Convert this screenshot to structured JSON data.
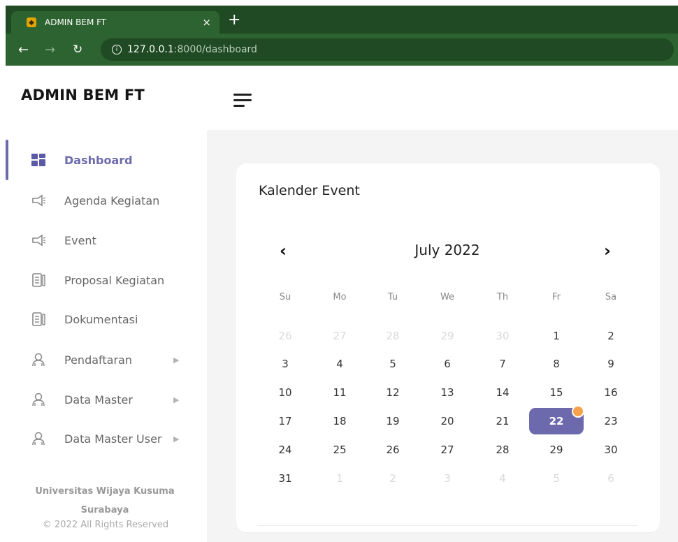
{
  "browser": {
    "tab_title": "ADMIN BEM FT",
    "tab_close": "×",
    "new_tab": "+",
    "url_host": "127.0.0.1",
    "url_path": ":8000/dashboard"
  },
  "app": {
    "brand": "ADMIN BEM FT",
    "accent_color": "#6c6aad",
    "event_dot_color": "#f5a34a"
  },
  "sidebar": {
    "items": [
      {
        "label": "Dashboard",
        "icon": "dashboard-grid-icon",
        "active": true
      },
      {
        "label": "Agenda Kegiatan",
        "icon": "megaphone-icon"
      },
      {
        "label": "Event",
        "icon": "megaphone-icon"
      },
      {
        "label": "Proposal Kegiatan",
        "icon": "document-icon"
      },
      {
        "label": "Dokumentasi",
        "icon": "document-icon"
      },
      {
        "label": "Pendaftaran",
        "icon": "users-icon",
        "has_submenu": true
      },
      {
        "label": "Data Master",
        "icon": "users-icon",
        "has_submenu": true
      },
      {
        "label": "Data Master User",
        "icon": "users-icon",
        "has_submenu": true
      }
    ],
    "footer": {
      "line1": "Universitas Wijaya Kusuma",
      "line2": "Surabaya",
      "copyright": "© 2022 All Rights Reserved"
    }
  },
  "calendar": {
    "title": "Kalender Event",
    "month_label": "July 2022",
    "prev": "‹",
    "next": "›",
    "weekdays": [
      "Su",
      "Mo",
      "Tu",
      "We",
      "Th",
      "Fr",
      "Sa"
    ],
    "weeks": [
      [
        {
          "d": "26",
          "muted": true
        },
        {
          "d": "27",
          "muted": true
        },
        {
          "d": "28",
          "muted": true
        },
        {
          "d": "29",
          "muted": true
        },
        {
          "d": "30",
          "muted": true
        },
        {
          "d": "1"
        },
        {
          "d": "2"
        }
      ],
      [
        {
          "d": "3"
        },
        {
          "d": "4"
        },
        {
          "d": "5"
        },
        {
          "d": "6"
        },
        {
          "d": "7"
        },
        {
          "d": "8"
        },
        {
          "d": "9"
        }
      ],
      [
        {
          "d": "10"
        },
        {
          "d": "11"
        },
        {
          "d": "12"
        },
        {
          "d": "13"
        },
        {
          "d": "14"
        },
        {
          "d": "15"
        },
        {
          "d": "16"
        }
      ],
      [
        {
          "d": "17"
        },
        {
          "d": "18"
        },
        {
          "d": "19"
        },
        {
          "d": "20"
        },
        {
          "d": "21"
        },
        {
          "d": "22",
          "selected": true,
          "has_event": true
        },
        {
          "d": "23"
        }
      ],
      [
        {
          "d": "24"
        },
        {
          "d": "25"
        },
        {
          "d": "26"
        },
        {
          "d": "27"
        },
        {
          "d": "28"
        },
        {
          "d": "29"
        },
        {
          "d": "30"
        }
      ],
      [
        {
          "d": "31"
        },
        {
          "d": "1",
          "muted": true
        },
        {
          "d": "2",
          "muted": true
        },
        {
          "d": "3",
          "muted": true
        },
        {
          "d": "4",
          "muted": true
        },
        {
          "d": "5",
          "muted": true
        },
        {
          "d": "6",
          "muted": true
        }
      ]
    ]
  }
}
